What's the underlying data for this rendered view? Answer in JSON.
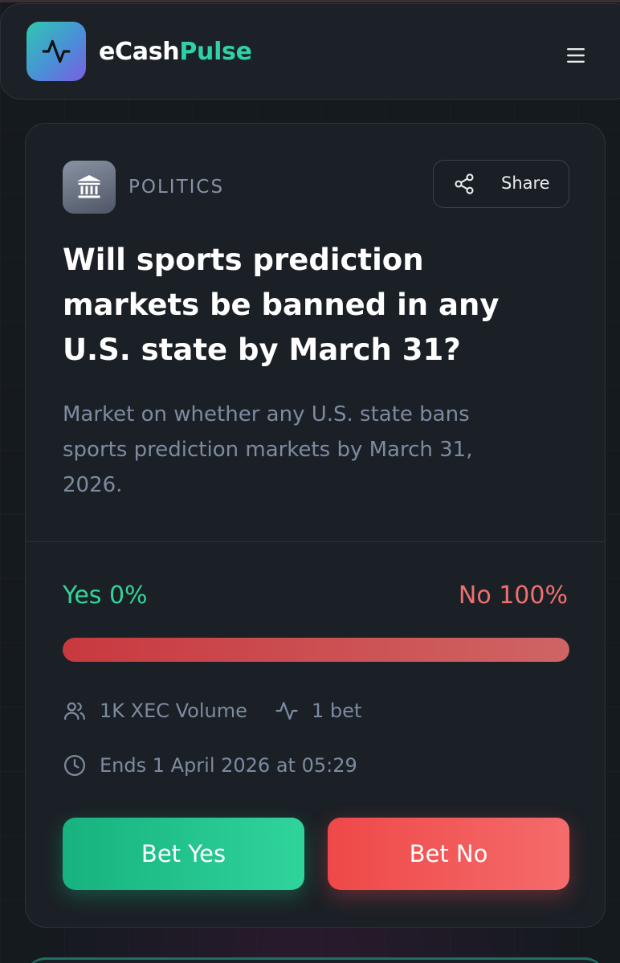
{
  "header": {
    "brand_part1": "eCash",
    "brand_part2": "Pulse",
    "logo_icon": "activity-pulse-icon",
    "menu_icon": "hamburger-menu-icon"
  },
  "market": {
    "category": "POLITICS",
    "category_icon": "bank-building-icon",
    "share_label": "Share",
    "title": "Will sports prediction markets be banned in any U.S. state by March 31?",
    "description": "Market on whether any U.S. state bans sports prediction markets by March 31, 2026.",
    "yes_label": "Yes 0%",
    "no_label": "No 100%",
    "probability_yes_pct": 0,
    "probability_no_pct": 100,
    "volume": "1K XEC Volume",
    "bets": "1 bet",
    "ends": "Ends 1 April 2026 at 05:29",
    "bet_yes_label": "Bet Yes",
    "bet_no_label": "Bet No"
  },
  "colors": {
    "accent": "#2fd1a6",
    "yes": "#34d399",
    "no": "#f07070",
    "background": "#151a1f"
  }
}
